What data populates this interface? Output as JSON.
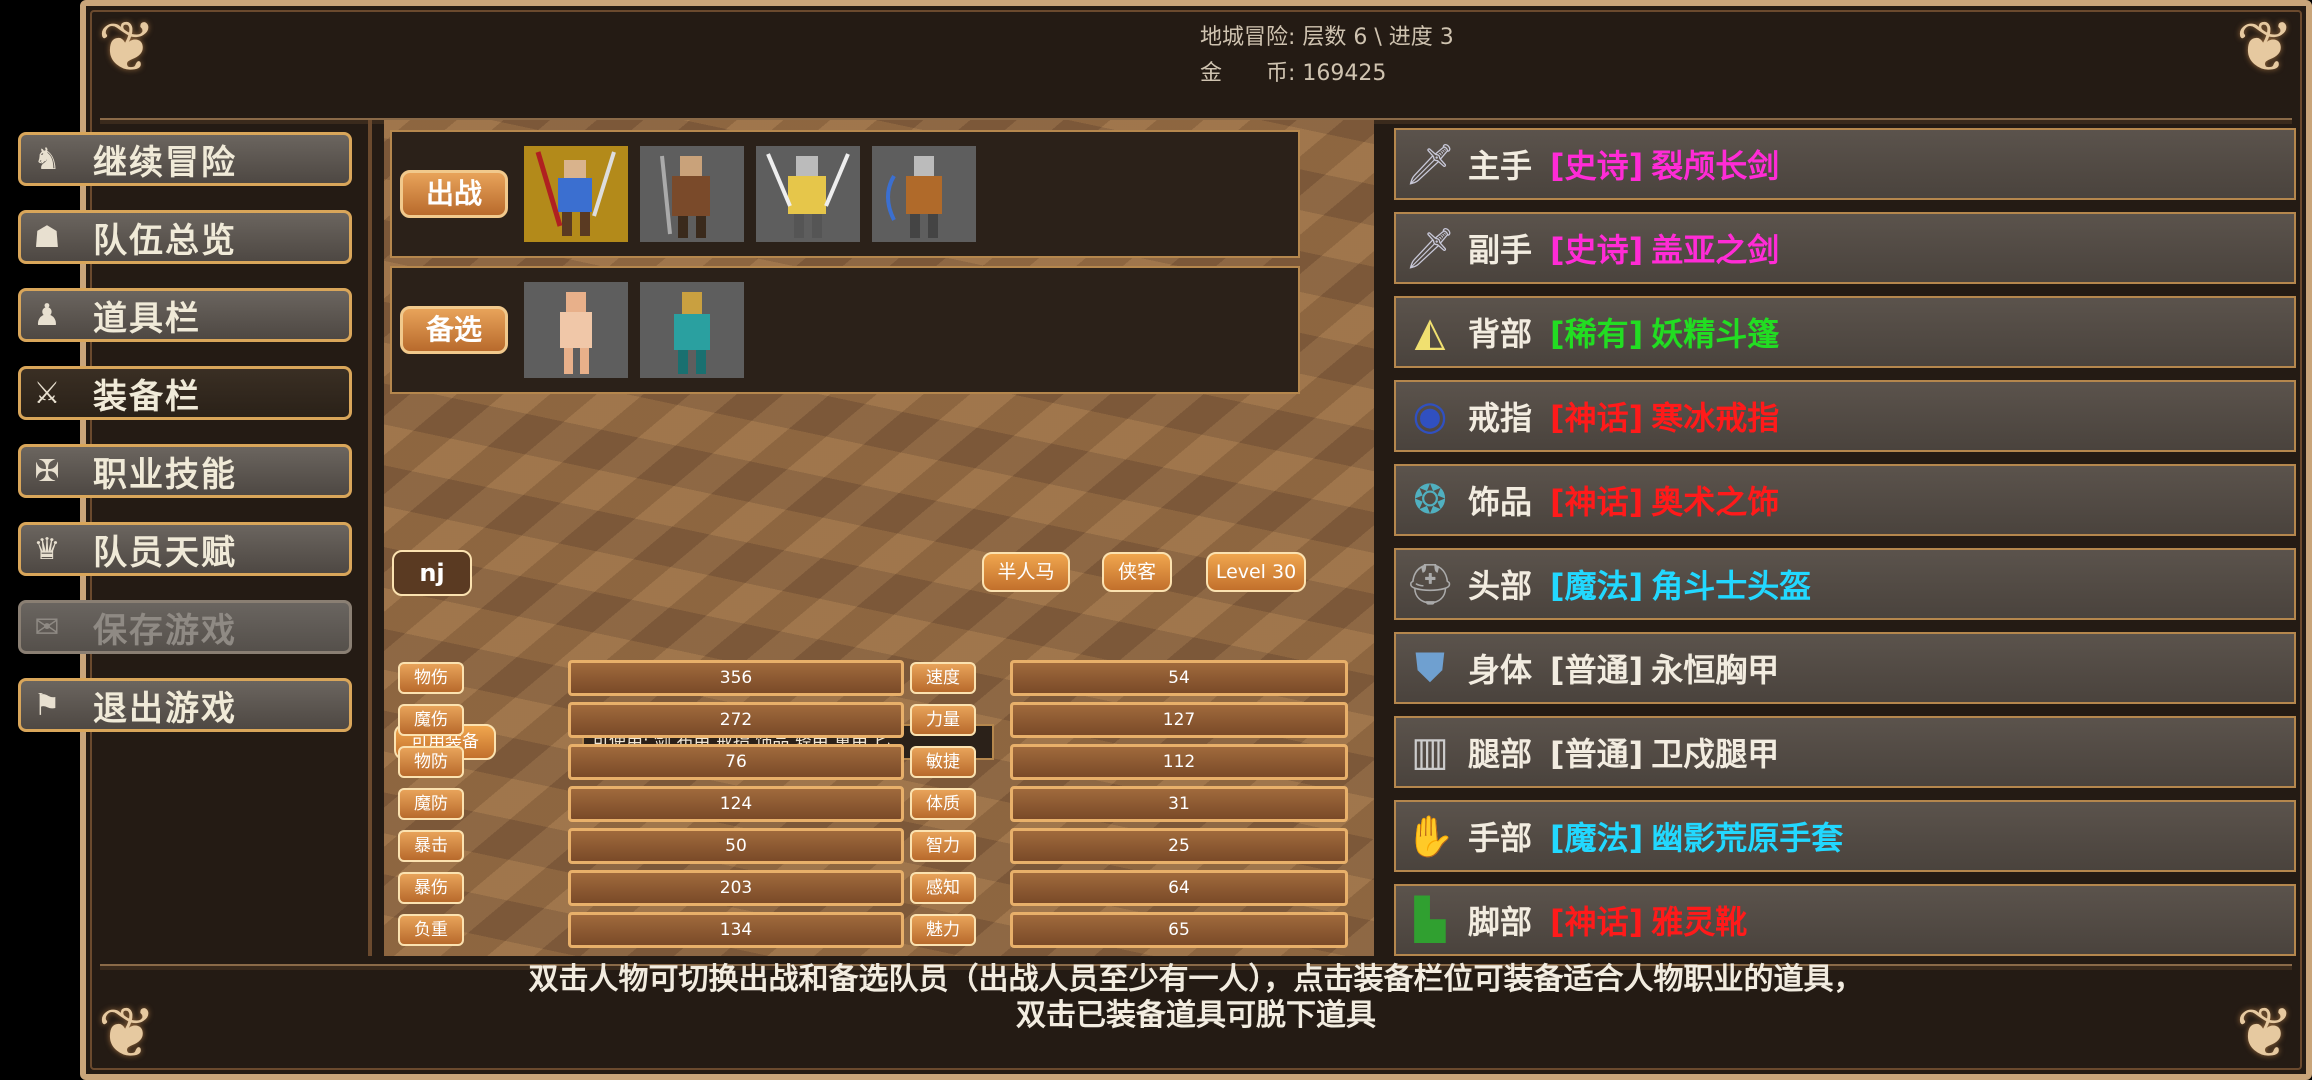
{
  "header": {
    "dungeon_line": "地城冒险: 层数 6 \\ 进度 3",
    "gold_line": "金　　币: 169425"
  },
  "menu": [
    {
      "label": "继续冒险",
      "icon": "dragon-icon"
    },
    {
      "label": "队伍总览",
      "icon": "party-icon"
    },
    {
      "label": "道具栏",
      "icon": "bag-icon"
    },
    {
      "label": "装备栏",
      "icon": "equipment-icon"
    },
    {
      "label": "职业技能",
      "icon": "skill-icon"
    },
    {
      "label": "队员天赋",
      "icon": "talent-icon"
    },
    {
      "label": "保存游戏",
      "icon": "scroll-icon"
    },
    {
      "label": "退出游戏",
      "icon": "flag-icon"
    }
  ],
  "party": {
    "active_label": "出战",
    "reserve_label": "备选"
  },
  "character": {
    "name": "nj",
    "race": "半人马",
    "class": "侠客",
    "level": "Level 30",
    "usable_button": "可用装备",
    "usable_text": "可使用:  剑 布甲 戒指 饰品 轻甲 重甲 匕"
  },
  "stats_left": [
    {
      "label": "物伤",
      "value": "356"
    },
    {
      "label": "魔伤",
      "value": "272"
    },
    {
      "label": "物防",
      "value": "76"
    },
    {
      "label": "魔防",
      "value": "124"
    },
    {
      "label": "暴击",
      "value": "50"
    },
    {
      "label": "暴伤",
      "value": "203"
    },
    {
      "label": "负重",
      "value": "134"
    }
  ],
  "stats_right": [
    {
      "label": "速度",
      "value": "54"
    },
    {
      "label": "力量",
      "value": "127"
    },
    {
      "label": "敏捷",
      "value": "112"
    },
    {
      "label": "体质",
      "value": "31"
    },
    {
      "label": "智力",
      "value": "25"
    },
    {
      "label": "感知",
      "value": "64"
    },
    {
      "label": "魅力",
      "value": "65"
    }
  ],
  "equipment": [
    {
      "slot": "主手",
      "rarity": "[史诗]",
      "name": "裂颅长剑",
      "color": "#ff2bd6",
      "icon": "sword-icon"
    },
    {
      "slot": "副手",
      "rarity": "[史诗]",
      "name": "盖亚之剑",
      "color": "#ff2bd6",
      "icon": "sword-icon"
    },
    {
      "slot": "背部",
      "rarity": "[稀有]",
      "name": "妖精斗篷",
      "color": "#22dd22",
      "icon": "cloak-icon"
    },
    {
      "slot": "戒指",
      "rarity": "[神话]",
      "name": "寒冰戒指",
      "color": "#ff1a1a",
      "icon": "ring-icon"
    },
    {
      "slot": "饰品",
      "rarity": "[神话]",
      "name": "奥术之饰",
      "color": "#ff1a1a",
      "icon": "amulet-icon"
    },
    {
      "slot": "头部",
      "rarity": "[魔法]",
      "name": "角斗士头盔",
      "color": "#22d8ff",
      "icon": "helmet-icon"
    },
    {
      "slot": "身体",
      "rarity": "[普通]",
      "name": "永恒胸甲",
      "color": "#f2ece0",
      "icon": "armor-icon"
    },
    {
      "slot": "腿部",
      "rarity": "[普通]",
      "name": "卫戍腿甲",
      "color": "#f2ece0",
      "icon": "greaves-icon"
    },
    {
      "slot": "手部",
      "rarity": "[魔法]",
      "name": "幽影荒原手套",
      "color": "#22d8ff",
      "icon": "gauntlet-icon"
    },
    {
      "slot": "脚部",
      "rarity": "[神话]",
      "name": "雅灵靴",
      "color": "#ff1a1a",
      "icon": "boots-icon"
    }
  ],
  "footer": {
    "line1": "双击人物可切换出战和备选队员（出战人员至少有一人），点击装备栏位可装备适合人物职业的道具，",
    "line2": "双击已装备道具可脱下道具"
  }
}
